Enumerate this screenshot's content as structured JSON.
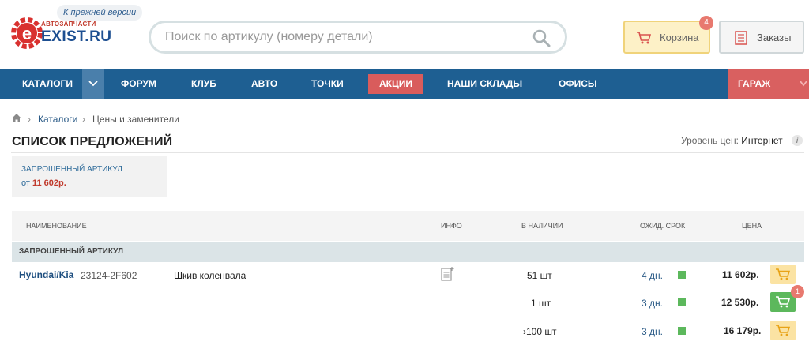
{
  "header": {
    "prev_version": "К прежней версии",
    "logo_sub": "АВТОЗАПЧАСТИ",
    "logo_main": "EXIST.RU",
    "search_placeholder": "Поиск по артикулу (номеру детали)",
    "cart_label": "Корзина",
    "cart_count": "4",
    "orders_label": "Заказы"
  },
  "nav": {
    "items": [
      "КАТАЛОГИ",
      "ФОРУМ",
      "КЛУБ",
      "АВТО",
      "ТОЧКИ",
      "АКЦИИ",
      "НАШИ СКЛАДЫ",
      "ОФИСЫ"
    ],
    "garage": "ГАРАЖ"
  },
  "breadcrumb": {
    "items": [
      "Каталоги",
      "Цены и заменители"
    ]
  },
  "page": {
    "title": "СПИСОК ПРЕДЛОЖЕНИЙ",
    "price_level_label": "Уровень цен:",
    "price_level_value": "Интернет",
    "info_glyph": "i"
  },
  "requested": {
    "title": "ЗАПРОШЕННЫЙ АРТИКУЛ",
    "price_prefix": "от",
    "price": "11 602р."
  },
  "table": {
    "headers": {
      "name": "НАИМЕНОВАНИЕ",
      "info": "ИНФО",
      "stock": "В НАЛИЧИИ",
      "term": "ОЖИД. СРОК",
      "price": "ЦЕНА"
    },
    "group": "ЗАПРОШЕННЫЙ АРТИКУЛ",
    "part": {
      "brand": "Hyundai/Kia",
      "article": "23124-2F602",
      "name": "Шкив коленвала"
    },
    "rows": [
      {
        "qty": "51 шт",
        "term": "4 дн.",
        "price": "11 602р.",
        "status_color": "#5cb85c",
        "in_cart": false
      },
      {
        "qty": "1 шт",
        "term": "3 дн.",
        "price": "12 530р.",
        "status_color": "#5cb85c",
        "in_cart": true,
        "cart_count": "1"
      },
      {
        "qty": "›100 шт",
        "term": "3 дн.",
        "price": "16 179р.",
        "status_color": "#5cb85c",
        "in_cart": false
      }
    ]
  },
  "colors": {
    "nav_bg": "#1e5f92",
    "promo": "#d95c5c",
    "garage": "#d96060",
    "brand_blue": "#1d4f91",
    "price_red": "#c0392b",
    "status_green": "#5cb85c"
  }
}
